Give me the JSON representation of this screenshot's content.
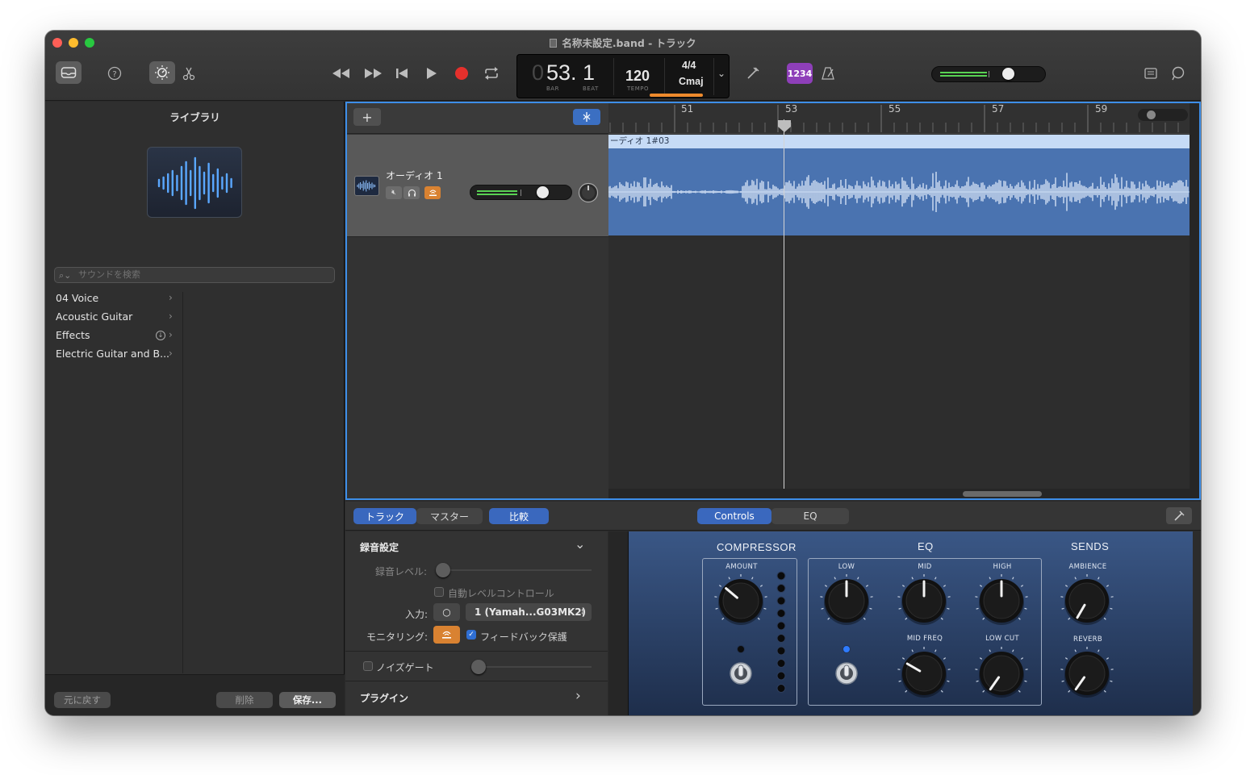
{
  "window": {
    "title": "名称未設定.band - トラック"
  },
  "lcd": {
    "bar_prefix": "0",
    "position": "53. 1",
    "bar_label": "BAR",
    "beat_label": "BEAT",
    "tempo": "120",
    "tempo_label": "TEMPO",
    "signature": "4/4",
    "key": "Cmaj"
  },
  "toolbar": {
    "count_in": "1234"
  },
  "library": {
    "title": "ライブラリ",
    "search_placeholder": "サウンドを検索",
    "categories": [
      {
        "label": "04 Voice"
      },
      {
        "label": "Acoustic Guitar"
      },
      {
        "label": "Effects"
      },
      {
        "label": "Electric Guitar and B..."
      }
    ],
    "revert": "元に戻す",
    "delete": "削除",
    "save": "保存..."
  },
  "track": {
    "name": "オーディオ 1",
    "region_name": "ーディオ 1#03"
  },
  "ruler": {
    "bars": [
      "51",
      "53",
      "55",
      "57",
      "59"
    ]
  },
  "smart_controls": {
    "tabs": {
      "track": "トラック",
      "master": "マスター",
      "compare": "比較"
    },
    "view_tabs": {
      "controls": "Controls",
      "eq": "EQ"
    },
    "recording": {
      "section_title": "録音設定",
      "level_label": "録音レベル:",
      "auto_level": "自動レベルコントロール",
      "input_label": "入力:",
      "input_device": "1 (Yamah...G03MK2)",
      "monitoring_label": "モニタリング:",
      "feedback": "フィードバック保護",
      "noise_gate": "ノイズゲート",
      "plugins": "プラグイン"
    },
    "plugin": {
      "compressor_title": "COMPRESSOR",
      "eq_title": "EQ",
      "sends_title": "SENDS",
      "amount": "AMOUNT",
      "low": "LOW",
      "mid": "MID",
      "high": "HIGH",
      "mid_freq": "MID FREQ",
      "low_cut": "LOW CUT",
      "ambience": "AMBIENCE",
      "reverb": "REVERB"
    }
  }
}
